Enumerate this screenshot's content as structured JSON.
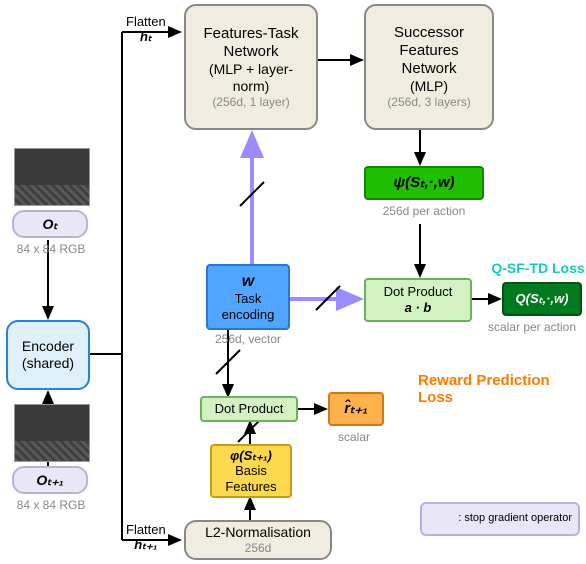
{
  "obs": {
    "ot_label": "Oₜ",
    "ot_dim": "84 x 84 RGB",
    "otp1_label": "Oₜ₊₁",
    "otp1_dim": "84 x 84 RGB"
  },
  "encoder": {
    "title": "Encoder\n(shared)"
  },
  "flatten": {
    "ht": "Flatten",
    "ht_var": "hₜ",
    "htp1": "Flatten",
    "htp1_var": "hₜ₊₁"
  },
  "ftask": {
    "title": "Features-Task\nNetwork",
    "sub": "(MLP + layer-\nnorm)",
    "dim": "(256d, 1 layer)"
  },
  "sfn": {
    "title": "Successor\nFeatures\nNetwork",
    "sub": "(MLP)",
    "dim": "(256d, 3 layers)"
  },
  "psi": {
    "formula": "ψ(Sₜ,·,w)",
    "dim": "256d per action"
  },
  "q": {
    "formula": "Q(Sₜ,·,w)",
    "dim": "scalar per action",
    "loss": "Q-SF-TD Loss"
  },
  "w": {
    "var": "w",
    "title": "Task\nencoding",
    "dim": "256d, vector"
  },
  "dot1": {
    "title": "Dot Product",
    "formula": "a · b"
  },
  "dot2": {
    "title": "Dot Product"
  },
  "rhat": {
    "formula": "r̂ₜ₊₁",
    "dim": "scalar",
    "loss": "Reward Prediction\nLoss"
  },
  "phi": {
    "formula": "φ(Sₜ₊₁)",
    "title": "Basis\nFeatures"
  },
  "l2": {
    "title": "L2-Normalisation",
    "dim": "256d"
  },
  "legend": {
    "text": ": stop gradient operator"
  },
  "chart_data": {
    "type": "diagram",
    "nodes": [
      {
        "id": "Ot",
        "label": "Oₜ",
        "note": "84x84 RGB"
      },
      {
        "id": "Otp1",
        "label": "Oₜ₊₁",
        "note": "84x84 RGB"
      },
      {
        "id": "encoder",
        "label": "Encoder (shared)"
      },
      {
        "id": "flatten_ht",
        "label": "Flatten hₜ"
      },
      {
        "id": "flatten_htp1",
        "label": "Flatten hₜ₊₁"
      },
      {
        "id": "ftask",
        "label": "Features-Task Network (MLP + layer-norm)",
        "dim": "256d, 1 layer"
      },
      {
        "id": "sfn",
        "label": "Successor Features Network (MLP)",
        "dim": "256d, 3 layers"
      },
      {
        "id": "psi",
        "label": "ψ(Sₜ,·,w)",
        "dim": "256d per action"
      },
      {
        "id": "dot_ab",
        "label": "Dot Product a·b"
      },
      {
        "id": "Q",
        "label": "Q(Sₜ,·,w)",
        "dim": "scalar per action"
      },
      {
        "id": "w",
        "label": "w Task encoding",
        "dim": "256d vector"
      },
      {
        "id": "dot2",
        "label": "Dot Product"
      },
      {
        "id": "rhat",
        "label": "r̂ₜ₊₁",
        "dim": "scalar"
      },
      {
        "id": "phi",
        "label": "φ(Sₜ₊₁) Basis Features"
      },
      {
        "id": "l2",
        "label": "L2-Normalisation",
        "dim": "256d"
      }
    ],
    "edges": [
      {
        "from": "Ot",
        "to": "encoder"
      },
      {
        "from": "Otp1",
        "to": "encoder"
      },
      {
        "from": "encoder",
        "to": "flatten_ht"
      },
      {
        "from": "encoder",
        "to": "flatten_htp1"
      },
      {
        "from": "flatten_ht",
        "to": "ftask"
      },
      {
        "from": "ftask",
        "to": "sfn"
      },
      {
        "from": "sfn",
        "to": "psi"
      },
      {
        "from": "psi",
        "to": "dot_ab"
      },
      {
        "from": "dot_ab",
        "to": "Q"
      },
      {
        "from": "w",
        "to": "ftask",
        "stop_gradient": true
      },
      {
        "from": "w",
        "to": "dot_ab",
        "stop_gradient": true
      },
      {
        "from": "flatten_htp1",
        "to": "l2"
      },
      {
        "from": "l2",
        "to": "phi"
      },
      {
        "from": "phi",
        "to": "dot2",
        "stop_gradient": true
      },
      {
        "from": "w",
        "to": "dot2",
        "stop_gradient": true
      },
      {
        "from": "dot2",
        "to": "rhat"
      }
    ],
    "losses": [
      {
        "name": "Q-SF-TD Loss",
        "at": "Q"
      },
      {
        "name": "Reward Prediction Loss",
        "at": "rhat"
      }
    ],
    "legend": "\\ : stop gradient operator"
  }
}
